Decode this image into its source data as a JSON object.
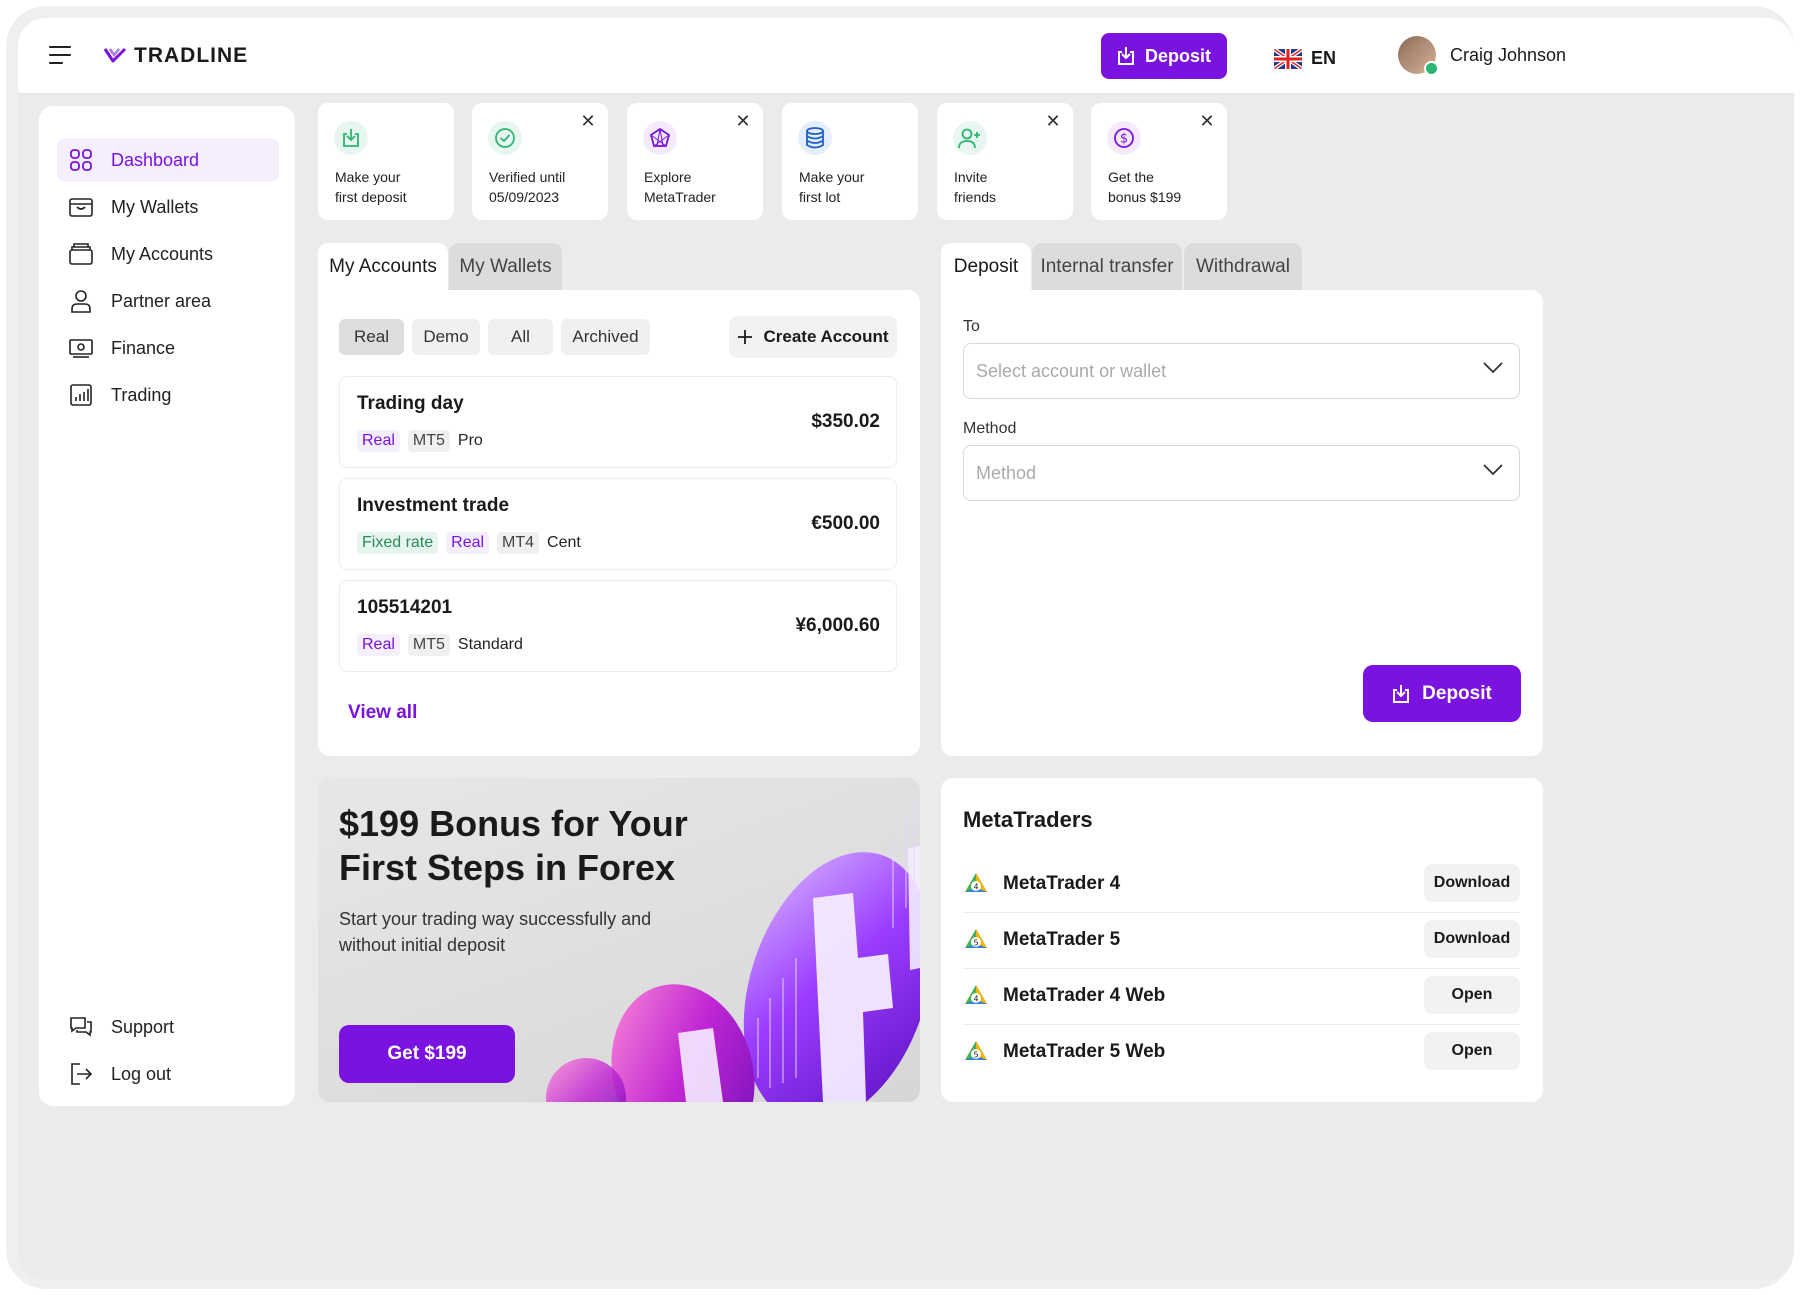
{
  "header": {
    "logo_text": "TRADLINE",
    "deposit_label": "Deposit",
    "language": "EN",
    "user_name": "Craig Johnson"
  },
  "sidebar": {
    "items": [
      {
        "label": "Dashboard",
        "icon": "dashboard-icon"
      },
      {
        "label": "My Wallets",
        "icon": "wallet-icon"
      },
      {
        "label": "My Accounts",
        "icon": "accounts-icon"
      },
      {
        "label": "Partner area",
        "icon": "user-icon"
      },
      {
        "label": "Finance",
        "icon": "finance-icon"
      },
      {
        "label": "Trading",
        "icon": "trading-icon"
      }
    ],
    "bottom": [
      {
        "label": "Support",
        "icon": "support-icon"
      },
      {
        "label": "Log out",
        "icon": "logout-icon"
      }
    ]
  },
  "quick_cards": [
    {
      "line1": "Make your",
      "line2": "first deposit",
      "icon": "deposit-icon",
      "color": "#2bb673",
      "closable": false
    },
    {
      "line1": "Verified until",
      "line2": "05/09/2023",
      "icon": "check-circle-icon",
      "color": "#2bb673",
      "closable": true
    },
    {
      "line1": "Explore",
      "line2": "MetaTrader",
      "icon": "metatrader-icon",
      "color": "#7a12e0",
      "closable": true
    },
    {
      "line1": "Make your",
      "line2": "first lot",
      "icon": "database-icon",
      "color": "#1f5fc8",
      "closable": false
    },
    {
      "line1": "Invite",
      "line2": "friends",
      "icon": "add-user-icon",
      "color": "#2bb673",
      "closable": true
    },
    {
      "line1": "Get the",
      "line2": "bonus $199",
      "icon": "dollar-icon",
      "color": "#7a12e0",
      "closable": true
    }
  ],
  "accounts_panel": {
    "tabs": [
      "My Accounts",
      "My Wallets"
    ],
    "filters": [
      "Real",
      "Demo",
      "All",
      "Archived"
    ],
    "create_label": "Create Account",
    "accounts": [
      {
        "name": "Trading day",
        "amount": "$350.02",
        "tags": [
          {
            "text": "Real",
            "style": "purple"
          },
          {
            "text": "MT5",
            "style": "grey"
          },
          {
            "text": "Pro",
            "style": "plain"
          }
        ]
      },
      {
        "name": "Investment trade",
        "amount": "€500.00",
        "tags": [
          {
            "text": "Fixed rate",
            "style": "green"
          },
          {
            "text": "Real",
            "style": "purple"
          },
          {
            "text": "MT4",
            "style": "grey"
          },
          {
            "text": "Cent",
            "style": "plain"
          }
        ]
      },
      {
        "name": "105514201",
        "amount": "¥6,000.60",
        "tags": [
          {
            "text": "Real",
            "style": "purple"
          },
          {
            "text": "MT5",
            "style": "grey"
          },
          {
            "text": "Standard",
            "style": "plain"
          }
        ]
      }
    ],
    "view_all": "View all"
  },
  "transfer_panel": {
    "tabs": [
      "Deposit",
      "Internal transfer",
      "Withdrawal"
    ],
    "to_label": "To",
    "to_placeholder": "Select account or wallet",
    "method_label": "Method",
    "method_placeholder": "Method",
    "submit_label": "Deposit"
  },
  "promo": {
    "title_line1": "$199 Bonus for Your",
    "title_line2": "First Steps in Forex",
    "subtitle": "Start your trading way successfully and without initial deposit",
    "button": "Get $199"
  },
  "metatraders": {
    "title": "MetaTraders",
    "items": [
      {
        "name": "MetaTrader 4",
        "version": "4",
        "action": "Download"
      },
      {
        "name": "MetaTrader 5",
        "version": "5",
        "action": "Download"
      },
      {
        "name": "MetaTrader 4 Web",
        "version": "4",
        "action": "Open"
      },
      {
        "name": "MetaTrader 5 Web",
        "version": "5",
        "action": "Open"
      }
    ]
  },
  "colors": {
    "accent": "#7a12e0",
    "accent_light": "#f5eefc",
    "green": "#2bb673",
    "background": "#ebebeb"
  }
}
